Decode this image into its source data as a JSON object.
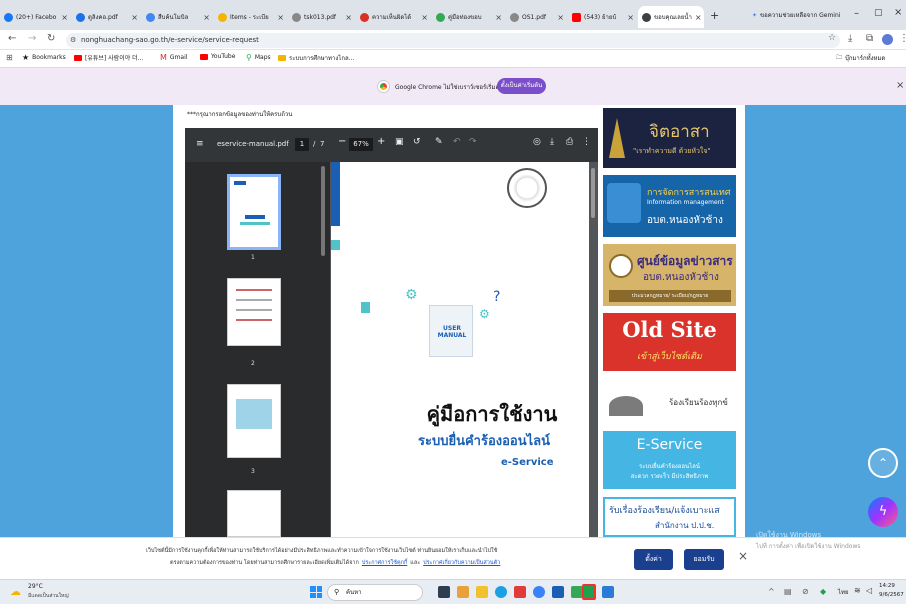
{
  "tabs": [
    {
      "label": "(20+) Facebo",
      "color": "#1877f2"
    },
    {
      "label": "ดูลิงคอ.pdf",
      "color": "#1a73e8"
    },
    {
      "label": "สืบค้นโมบิล",
      "color": "#4285f4"
    },
    {
      "label": "Items - ระเบีย",
      "color": "#f4b400"
    },
    {
      "label": "tsk013.pdf",
      "color": "#555"
    },
    {
      "label": "ความเห็นผิดได้",
      "color": "#d93025"
    },
    {
      "label": "คู่มือท่องขอบ",
      "color": "#34a853"
    },
    {
      "label": "OS1.pdf",
      "color": "#555"
    },
    {
      "label": "(543) ย้ายบ้",
      "color": "#ff0000"
    },
    {
      "label": "ขอบคุณเลยน้ำ",
      "color": "#3c4043"
    }
  ],
  "gemini_tab": "ขอความช่วยเหลือจาก Gemini",
  "url": "nonghuachang-sao.go.th/e-service/service-request",
  "bookmarks": [
    "Bookmarks",
    "[유튜브] 사람이야 더...",
    "Gmail",
    "YouTube",
    "Maps",
    "ระบบการศึกษาทางไกล..."
  ],
  "all_bookmarks": "บุ๊กมาร์กทั้งหมด",
  "infobar": {
    "text": "Google Chrome ไม่ใช่เบราว์เซอร์เริ่มต้น",
    "button": "ตั้งเป็นค่าเริ่มต้น"
  },
  "note": "***กรุณากรอกข้อมูลของท่านให้ครบถ้วน",
  "pdf": {
    "filename": "eservice-manual.pdf",
    "page": "1",
    "pages": "7",
    "zoom": "67%",
    "thumbs": [
      "1",
      "2",
      "3"
    ],
    "title": "คู่มือการใช้งาน",
    "subtitle": "ระบบยื่นคำร้องออนไลน์",
    "eservice": "e-Service",
    "user_manual": "USER MANUAL"
  },
  "sidebar": {
    "jitarsa": "จิตอาสา",
    "jitarsa_sub": "\"เราทำความดี ด้วยหัวใจ\"",
    "info_mgmt_th": "การจัดการสารสนเทศ",
    "info_mgmt_en": "Information management",
    "info_mgmt_org": "อบต.หนองหัวช้าง",
    "news_center": "ศูนย์ข้อมูลข่าวสาร",
    "news_org": "อบต.หนองหัวช้าง",
    "news_sub": "ประมวลกฎหมาย/ ระเบียบ/กฎหมาย",
    "old_site": "Old Site",
    "old_site_sub": "เข้าสู่เว็บไซต์เดิม",
    "complaint": "ร้องเรียนร้องทุกข์",
    "eservice": "E-Service",
    "eservice_sub1": "ระบบยื่นคำร้องออนไลน์",
    "eservice_sub2": "สะดวก รวดเร็ว มีประสิทธิภาพ",
    "receive": "รับเรื่องร้องเรียน/แจ้งเบาะแส",
    "receive_sub": "สำนักงาน ป.ป.ช."
  },
  "windows_watermark": {
    "line1": "เปิดใช้งาน Windows",
    "line2": "ไปที่ การตั้งค่า เพื่อเปิดใช้งาน Windows"
  },
  "cookie": {
    "line1": "เว็บไซต์นี้มีการใช้งานคุกกี้เพื่อให้ท่านสามารถใช้บริการได้อย่างมีประสิทธิภาพและทำความเข้าใจการใช้งานเว็บไซต์ ท่านยินยอมให้เราเก็บและนำไปใช้",
    "line2": "ตรงตามความต้องการของท่าน โดยท่านสามารถศึกษารายละเอียดเพิ่มเติมได้จาก",
    "link1": "ประกาศการใช้คุกกี้",
    "and": "และ",
    "link2": "ประกาศเกี่ยวกับความเป็นส่วนตัว",
    "settings": "ตั้งค่า",
    "accept": "ยอมรับ",
    "close": "×"
  },
  "taskbar": {
    "weather_temp": "29°C",
    "weather_text": "มีแดดเป็นส่วนใหญ่",
    "search": "ค้นหา",
    "time": "14:29",
    "date": "9/6/2567",
    "lang": "ไทย"
  },
  "colors": {
    "tabbar": "#dee3ea",
    "page_bg": "#4ea3dd",
    "infobar": "#f2e9f7",
    "pdf_toolbar": "#323639",
    "primary": "#1a5fb4",
    "teal": "#4fc3c8"
  }
}
